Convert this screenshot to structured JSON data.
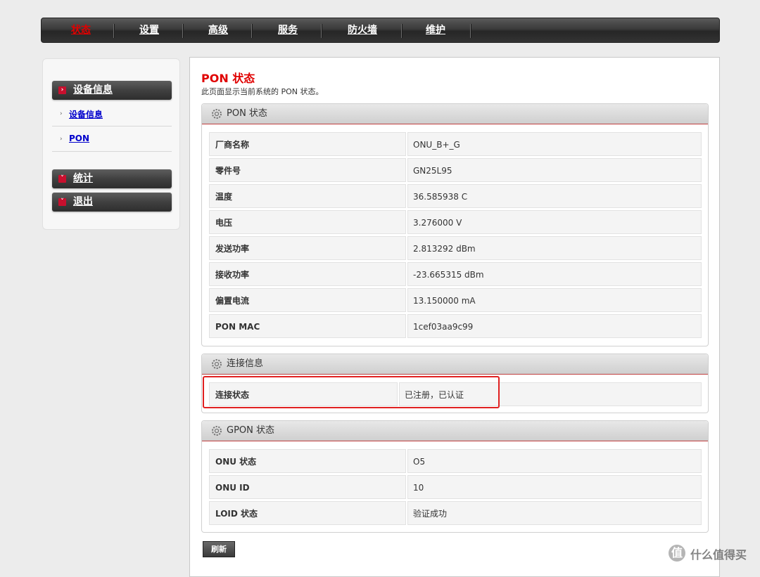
{
  "nav": {
    "items": [
      {
        "label": "状态",
        "active": true
      },
      {
        "label": "设置"
      },
      {
        "label": "高级"
      },
      {
        "label": "服务"
      },
      {
        "label": "防火墙"
      },
      {
        "label": "维护"
      }
    ]
  },
  "sidebar": {
    "device_info_header": "设备信息",
    "sub_items": [
      {
        "label": "设备信息"
      },
      {
        "label": "PON"
      }
    ],
    "stats_header": "统计",
    "logout_header": "退出"
  },
  "page": {
    "title": "PON 状态",
    "description": "此页面显示当前系统的 PON 状态。"
  },
  "pon_status": {
    "title": "PON 状态",
    "rows": [
      {
        "key": "厂商名称",
        "value": "ONU_B+_G"
      },
      {
        "key": "零件号",
        "value": "GN25L95"
      },
      {
        "key": "温度",
        "value": "36.585938 C"
      },
      {
        "key": "电压",
        "value": "3.276000 V"
      },
      {
        "key": "发送功率",
        "value": "2.813292 dBm"
      },
      {
        "key": "接收功率",
        "value": "-23.665315 dBm"
      },
      {
        "key": "偏置电流",
        "value": "13.150000 mA"
      },
      {
        "key": "PON MAC",
        "value": "1cef03aa9c99"
      }
    ]
  },
  "connection": {
    "title": "连接信息",
    "rows": [
      {
        "key": "连接状态",
        "value": "已注册，已认证"
      }
    ]
  },
  "gpon_status": {
    "title": "GPON 状态",
    "rows": [
      {
        "key": "ONU 状态",
        "value": "O5"
      },
      {
        "key": "ONU ID",
        "value": "10"
      },
      {
        "key": "LOID 状态",
        "value": "验证成功"
      }
    ]
  },
  "refresh_label": "刷新",
  "watermark": {
    "icon": "值",
    "text": "什么值得买"
  },
  "colors": {
    "accent": "#e00000",
    "nav_bg": "#333333",
    "highlight": "#e02020"
  }
}
